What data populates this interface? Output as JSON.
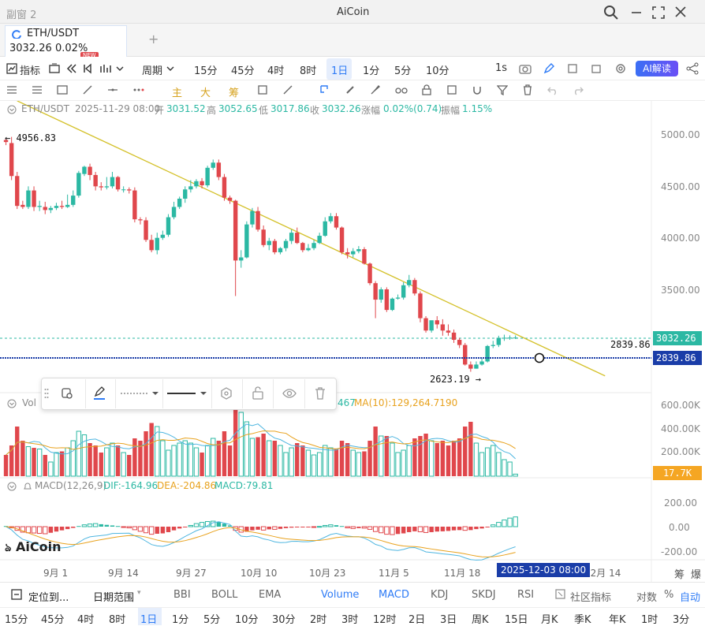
{
  "window": {
    "left_title": "副窗 2",
    "app_title": "AiCoin"
  },
  "tab": {
    "pair": "ETH/USDT",
    "price": "3032.26",
    "change": "0.02%",
    "new_badge": "NEW",
    "add": "+"
  },
  "toolbar": {
    "indicator_label": "指标",
    "period_label": "周期",
    "periods": [
      "15分",
      "45分",
      "4时",
      "8时",
      "1日",
      "1分",
      "5分",
      "10分"
    ],
    "active_period": "1日",
    "refresh": "1s",
    "ai_label": "AI解读"
  },
  "drawbar": {
    "chars": [
      "主",
      "大",
      "筹"
    ]
  },
  "info_bar": {
    "pair": "ETH/USDT",
    "time": "2025-11-29 08:00",
    "open_label": "开",
    "open": "3031.52",
    "high_label": "高",
    "high": "3052.65",
    "low_label": "低",
    "low": "3017.86",
    "close_label": "收",
    "close": "3032.26",
    "chg_label": "涨幅",
    "chg": "0.02%(0.74)",
    "amp_label": "振幅",
    "amp": "1.15%"
  },
  "price_axis": [
    "5000.00",
    "4500.00",
    "4000.00",
    "3500.00"
  ],
  "price_markers": {
    "current": "3032.26",
    "crosshair": "2839.86",
    "crosshair_left": "2839.86",
    "high_mark": "4956.83",
    "low_mark": "2623.19"
  },
  "volume": {
    "label": "Vol",
    "ma5_tail": "467",
    "ma10": "MA(10):129,264.7190",
    "axis": [
      "600.00K",
      "400.00K",
      "200.00K"
    ],
    "current": "17.7K"
  },
  "macd": {
    "label": "MACD(12,26,9)",
    "dif": "DIF:-164.96",
    "dea": "DEA:-204.86",
    "macd": "MACD:79.81",
    "axis": [
      "200.00",
      "0.00",
      "-200.00"
    ]
  },
  "watermark": "AiCoin",
  "x_axis": [
    "9月 1",
    "9月 14",
    "9月 27",
    "10月 10",
    "10月 23",
    "11月 5",
    "11月 18",
    "12月 14"
  ],
  "x_cursor": "2025-12-03 08:00",
  "x_axis_right": [
    "筹",
    "爆"
  ],
  "bottom_tools": {
    "locate": "定位到...",
    "date_range": "日期范围",
    "indicators": [
      "BBI",
      "BOLL",
      "EMA",
      "Volume",
      "MACD",
      "KDJ",
      "SKDJ",
      "RSI"
    ],
    "community": "社区指标",
    "log": "对数",
    "pct": "%",
    "auto": "自动"
  },
  "bottom_periods": [
    "15分",
    "45分",
    "4时",
    "8时",
    "1日",
    "1分",
    "5分",
    "10分",
    "30分",
    "2时",
    "3时",
    "12时",
    "2日",
    "3日",
    "周K",
    "15日",
    "月K",
    "季K",
    "年K",
    "1时",
    "3分"
  ],
  "bottom_active": "1日",
  "colors": {
    "up": "#2bb8a3",
    "down": "#e0474c",
    "trend": "#d4c12a",
    "accent": "#2f7cf6",
    "crosshair": "#1a3da8"
  },
  "chart_data": {
    "type": "candlestick",
    "x": [
      "2025-08-30",
      "2025-08-31",
      "2025-09-01",
      "2025-09-02",
      "2025-09-03",
      "2025-09-04",
      "2025-09-05",
      "2025-09-06",
      "2025-09-07",
      "2025-09-08",
      "2025-09-09",
      "2025-09-10",
      "2025-09-11",
      "2025-09-12",
      "2025-09-13",
      "2025-09-14",
      "2025-09-15",
      "2025-09-16",
      "2025-09-17",
      "2025-09-18",
      "2025-09-19",
      "2025-09-20",
      "2025-09-21",
      "2025-09-22",
      "2025-09-23",
      "2025-09-24",
      "2025-09-25",
      "2025-09-26",
      "2025-09-27",
      "2025-09-28",
      "2025-09-29",
      "2025-09-30",
      "2025-10-01",
      "2025-10-02",
      "2025-10-03",
      "2025-10-04",
      "2025-10-05",
      "2025-10-06",
      "2025-10-07",
      "2025-10-08",
      "2025-10-09",
      "2025-10-10",
      "2025-10-11",
      "2025-10-12",
      "2025-10-13",
      "2025-10-14",
      "2025-10-15",
      "2025-10-16",
      "2025-10-17",
      "2025-10-18",
      "2025-10-19",
      "2025-10-20",
      "2025-10-21",
      "2025-10-22",
      "2025-10-23",
      "2025-10-24",
      "2025-10-25",
      "2025-10-26",
      "2025-10-27",
      "2025-10-28",
      "2025-10-29",
      "2025-10-30",
      "2025-10-31",
      "2025-11-01",
      "2025-11-02",
      "2025-11-03",
      "2025-11-04",
      "2025-11-05",
      "2025-11-06",
      "2025-11-07",
      "2025-11-08",
      "2025-11-09",
      "2025-11-10",
      "2025-11-11",
      "2025-11-12",
      "2025-11-13",
      "2025-11-14",
      "2025-11-15",
      "2025-11-16",
      "2025-11-17",
      "2025-11-18",
      "2025-11-19",
      "2025-11-20",
      "2025-11-21",
      "2025-11-22",
      "2025-11-23",
      "2025-11-24",
      "2025-11-25",
      "2025-11-26",
      "2025-11-27",
      "2025-11-28",
      "2025-11-29"
    ],
    "open": [
      4950,
      4920,
      4600,
      4320,
      4300,
      4460,
      4300,
      4300,
      4270,
      4290,
      4310,
      4300,
      4320,
      4410,
      4620,
      4690,
      4610,
      4500,
      4490,
      4500,
      4590,
      4470,
      4470,
      4460,
      4180,
      4170,
      3980,
      3880,
      4000,
      4030,
      4200,
      4300,
      4380,
      4470,
      4500,
      4550,
      4510,
      4680,
      4730,
      4590,
      4390,
      4360,
      3780,
      3810,
      4130,
      4260,
      4080,
      3930,
      3970,
      3860,
      3900,
      3970,
      4050,
      3950,
      3880,
      3900,
      3950,
      4020,
      4160,
      4210,
      4100,
      3860,
      3840,
      3870,
      3890,
      3750,
      3560,
      3400,
      3500,
      3300,
      3410,
      3420,
      3540,
      3590,
      3460,
      3220,
      3100,
      3200,
      3160,
      3100,
      3080,
      3010,
      2960,
      2770,
      2730,
      2770,
      2800,
      2950,
      2960,
      3030,
      3030,
      3031.5
    ],
    "high": [
      4956.83,
      4980,
      4640,
      4360,
      4500,
      4500,
      4360,
      4350,
      4310,
      4340,
      4360,
      4420,
      4460,
      4650,
      4700,
      4720,
      4640,
      4540,
      4590,
      4640,
      4600,
      4500,
      4490,
      4490,
      4200,
      4200,
      4030,
      4050,
      4070,
      4230,
      4350,
      4400,
      4500,
      4560,
      4570,
      4580,
      4700,
      4760,
      4760,
      4620,
      4410,
      4370,
      3880,
      4160,
      4290,
      4300,
      4120,
      4000,
      3990,
      3910,
      3990,
      4080,
      4100,
      3960,
      3940,
      3980,
      4050,
      4200,
      4240,
      4240,
      4110,
      3900,
      3900,
      3920,
      3910,
      3760,
      3580,
      3520,
      3520,
      3420,
      3450,
      3570,
      3640,
      3610,
      3480,
      3240,
      3180,
      3240,
      3210,
      3160,
      3110,
      3030,
      2980,
      2800,
      2800,
      2830,
      2960,
      3000,
      3050,
      3060,
      3053,
      3052.65
    ],
    "low": [
      4900,
      4560,
      4280,
      4280,
      4280,
      4260,
      4260,
      4230,
      4240,
      4270,
      4280,
      4290,
      4300,
      4390,
      4600,
      4560,
      4460,
      4460,
      4470,
      4480,
      4450,
      4440,
      4430,
      4150,
      4130,
      3960,
      3860,
      3840,
      3980,
      4010,
      4180,
      4280,
      4340,
      4440,
      4480,
      4480,
      4490,
      4660,
      4560,
      4360,
      4330,
      3435,
      3710,
      3800,
      4100,
      4060,
      3910,
      3880,
      3840,
      3840,
      3870,
      3940,
      3940,
      3860,
      3870,
      3880,
      3940,
      4010,
      4140,
      4080,
      3840,
      3800,
      3810,
      3850,
      3740,
      3540,
      3220,
      3370,
      3280,
      3290,
      3400,
      3400,
      3520,
      3440,
      3180,
      3080,
      3080,
      3120,
      3050,
      3050,
      2980,
      2930,
      2760,
      2700,
      2730,
      2760,
      2790,
      2930,
      2940,
      3000,
      3010,
      3017.86
    ],
    "close": [
      4930,
      4600,
      4310,
      4300,
      4460,
      4300,
      4310,
      4270,
      4290,
      4310,
      4300,
      4320,
      4410,
      4630,
      4690,
      4610,
      4500,
      4490,
      4500,
      4590,
      4470,
      4470,
      4460,
      4180,
      4170,
      3980,
      3880,
      4000,
      4030,
      4200,
      4300,
      4380,
      4470,
      4500,
      4550,
      4510,
      4680,
      4730,
      4590,
      4390,
      4360,
      3780,
      3810,
      4130,
      4260,
      4080,
      3930,
      3970,
      3860,
      3900,
      3970,
      4050,
      3950,
      3880,
      3900,
      3950,
      4020,
      4160,
      4210,
      4100,
      3860,
      3840,
      3870,
      3890,
      3750,
      3560,
      3400,
      3500,
      3300,
      3410,
      3420,
      3540,
      3590,
      3460,
      3220,
      3100,
      3200,
      3160,
      3100,
      3080,
      3010,
      2960,
      2770,
      2730,
      2770,
      2800,
      2950,
      2960,
      3030,
      3030,
      3031.5,
      3032.26
    ],
    "volume_k": [
      180,
      260,
      420,
      300,
      250,
      240,
      230,
      180,
      120,
      200,
      210,
      240,
      300,
      380,
      350,
      280,
      260,
      200,
      240,
      280,
      260,
      200,
      180,
      320,
      300,
      380,
      450,
      420,
      300,
      220,
      260,
      280,
      300,
      280,
      240,
      200,
      260,
      320,
      300,
      380,
      260,
      560,
      540,
      460,
      320,
      330,
      360,
      300,
      300,
      260,
      200,
      240,
      280,
      260,
      220,
      180,
      200,
      260,
      240,
      230,
      300,
      280,
      220,
      200,
      210,
      300,
      420,
      340,
      340,
      280,
      200,
      220,
      260,
      320,
      340,
      360,
      300,
      280,
      300,
      260,
      300,
      320,
      420,
      460,
      280,
      200,
      240,
      260,
      200,
      140,
      120,
      17.7
    ],
    "macd_hist": [
      5,
      -10,
      -30,
      -45,
      -50,
      -52,
      -55,
      -58,
      -50,
      -40,
      -30,
      -20,
      -10,
      5,
      15,
      22,
      25,
      20,
      15,
      10,
      5,
      -5,
      -10,
      -25,
      -38,
      -50,
      -62,
      -58,
      -55,
      -45,
      -30,
      -15,
      -5,
      10,
      25,
      35,
      42,
      45,
      38,
      25,
      10,
      -30,
      -45,
      -42,
      -30,
      -25,
      -28,
      -22,
      -22,
      -18,
      -12,
      -8,
      -5,
      -3,
      -2,
      -2,
      2,
      10,
      15,
      12,
      5,
      -10,
      -15,
      -12,
      -12,
      -22,
      -40,
      -50,
      -62,
      -65,
      -60,
      -55,
      -45,
      -38,
      -42,
      -48,
      -45,
      -40,
      -38,
      -35,
      -30,
      -28,
      -30,
      -28,
      -20,
      -15,
      -5,
      15,
      35,
      55,
      70,
      79.81
    ],
    "price_ylim": [
      2550,
      5250
    ],
    "trendline": [
      [
        "2025-09-01",
        5330
      ],
      [
        "2025-12-15",
        2660
      ]
    ]
  }
}
